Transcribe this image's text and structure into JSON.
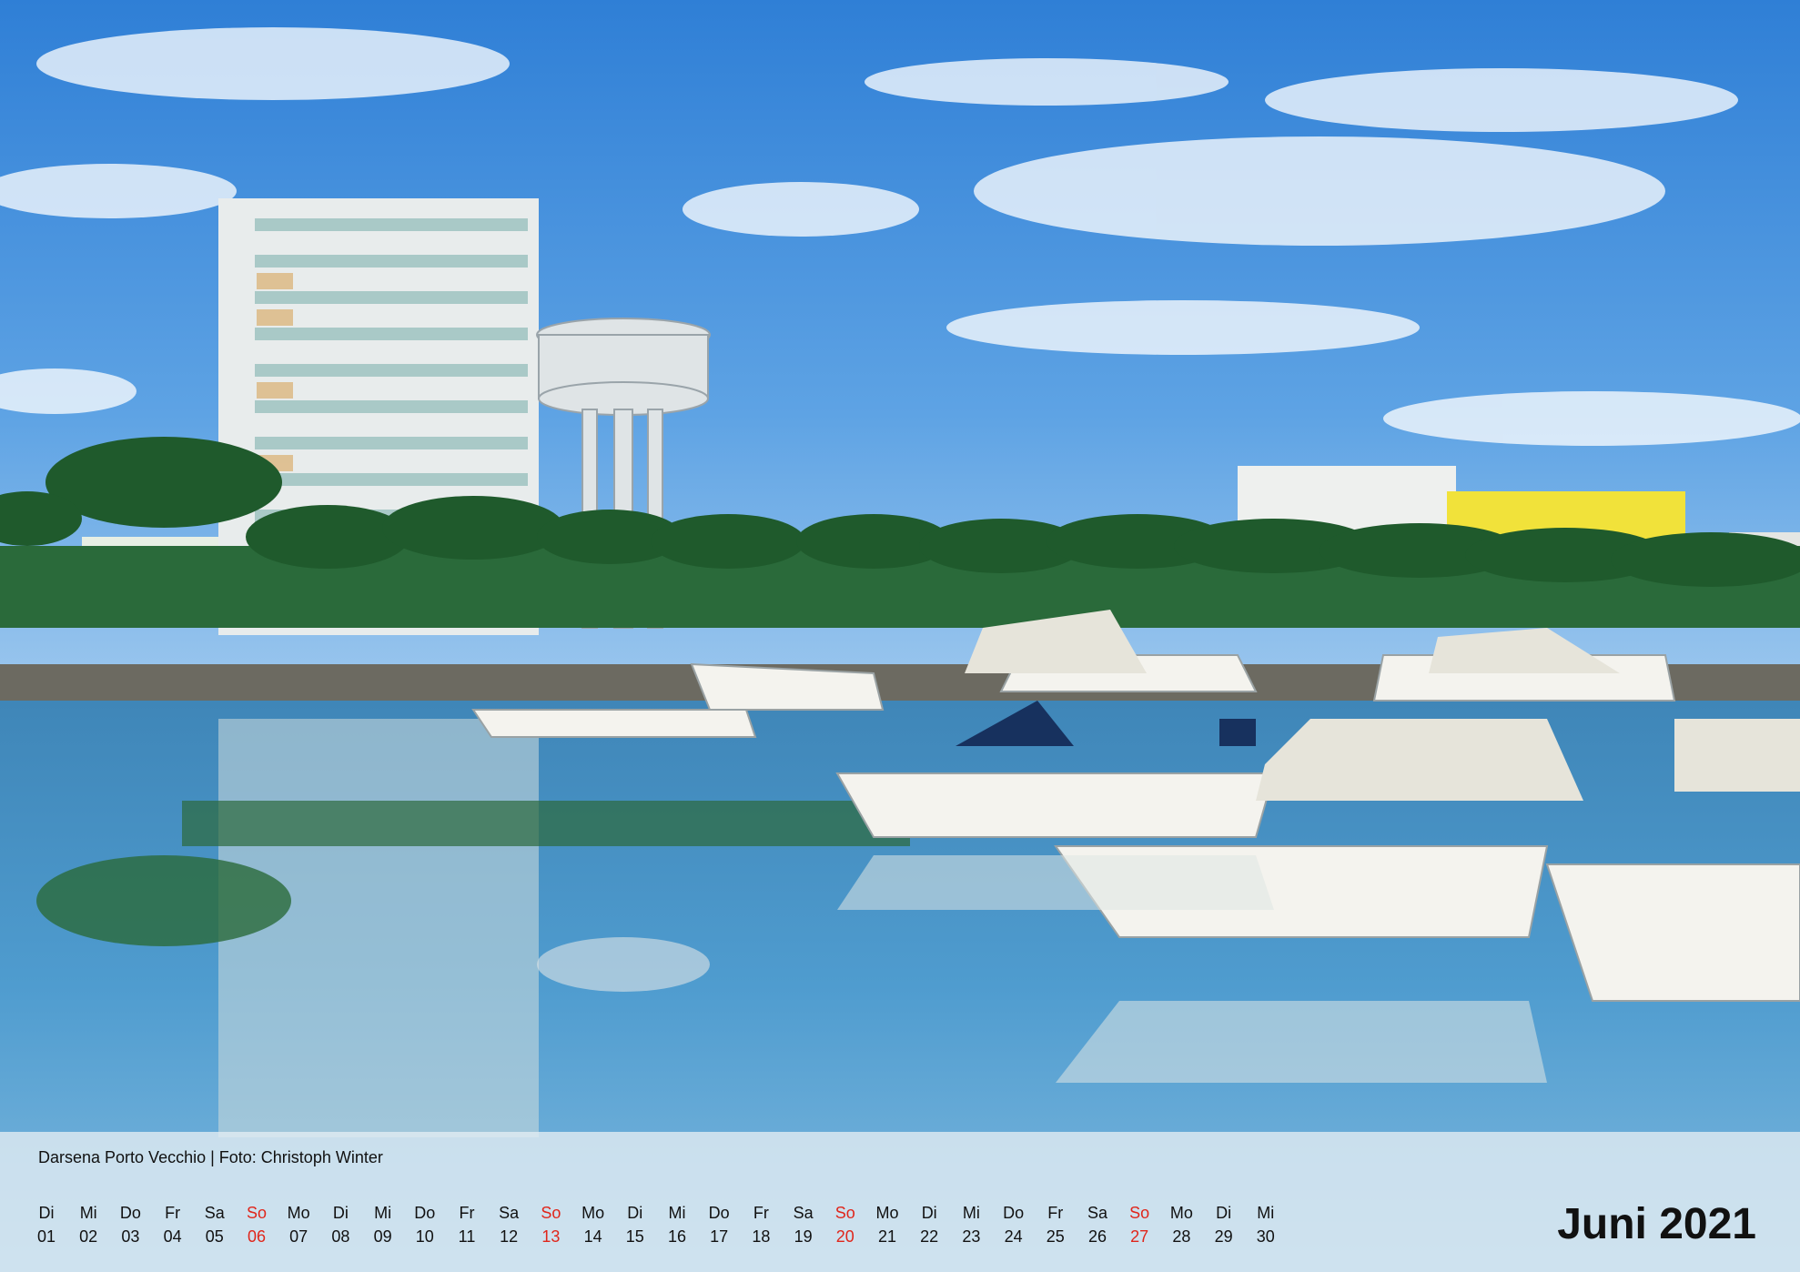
{
  "caption": "Darsena Porto Vecchio | Foto: Christoph Winter",
  "month_title": "Juni 2021",
  "colors": {
    "sunday": "#e0261b",
    "text": "#111111",
    "footer_band": "#e2ecf3"
  },
  "days": [
    {
      "name": "Di",
      "date": "01",
      "sunday": false
    },
    {
      "name": "Mi",
      "date": "02",
      "sunday": false
    },
    {
      "name": "Do",
      "date": "03",
      "sunday": false
    },
    {
      "name": "Fr",
      "date": "04",
      "sunday": false
    },
    {
      "name": "Sa",
      "date": "05",
      "sunday": false
    },
    {
      "name": "So",
      "date": "06",
      "sunday": true
    },
    {
      "name": "Mo",
      "date": "07",
      "sunday": false
    },
    {
      "name": "Di",
      "date": "08",
      "sunday": false
    },
    {
      "name": "Mi",
      "date": "09",
      "sunday": false
    },
    {
      "name": "Do",
      "date": "10",
      "sunday": false
    },
    {
      "name": "Fr",
      "date": "11",
      "sunday": false
    },
    {
      "name": "Sa",
      "date": "12",
      "sunday": false
    },
    {
      "name": "So",
      "date": "13",
      "sunday": true
    },
    {
      "name": "Mo",
      "date": "14",
      "sunday": false
    },
    {
      "name": "Di",
      "date": "15",
      "sunday": false
    },
    {
      "name": "Mi",
      "date": "16",
      "sunday": false
    },
    {
      "name": "Do",
      "date": "17",
      "sunday": false
    },
    {
      "name": "Fr",
      "date": "18",
      "sunday": false
    },
    {
      "name": "Sa",
      "date": "19",
      "sunday": false
    },
    {
      "name": "So",
      "date": "20",
      "sunday": true
    },
    {
      "name": "Mo",
      "date": "21",
      "sunday": false
    },
    {
      "name": "Di",
      "date": "22",
      "sunday": false
    },
    {
      "name": "Mi",
      "date": "23",
      "sunday": false
    },
    {
      "name": "Do",
      "date": "24",
      "sunday": false
    },
    {
      "name": "Fr",
      "date": "25",
      "sunday": false
    },
    {
      "name": "Sa",
      "date": "26",
      "sunday": false
    },
    {
      "name": "So",
      "date": "27",
      "sunday": true
    },
    {
      "name": "Mo",
      "date": "28",
      "sunday": false
    },
    {
      "name": "Di",
      "date": "29",
      "sunday": false
    },
    {
      "name": "Mi",
      "date": "30",
      "sunday": false
    }
  ]
}
